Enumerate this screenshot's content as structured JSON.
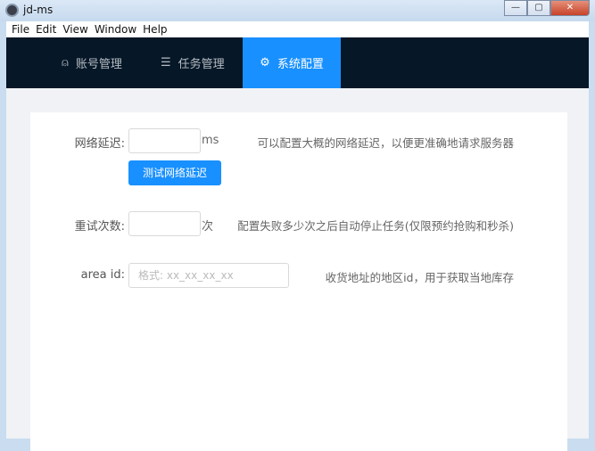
{
  "window": {
    "title": "jd-ms",
    "controls": {
      "minimize": "—",
      "maximize": "▢",
      "close": "✕"
    }
  },
  "menu": [
    "File",
    "Edit",
    "View",
    "Window",
    "Help"
  ],
  "nav": [
    {
      "label": "账号管理",
      "icon": "user-icon",
      "glyph": "⍝"
    },
    {
      "label": "任务管理",
      "icon": "list-icon",
      "glyph": "☰"
    },
    {
      "label": "系统配置",
      "icon": "gear-icon",
      "glyph": "⚙",
      "active": true
    }
  ],
  "form": {
    "delay": {
      "label": "网络延迟:",
      "value": "",
      "unit": "ms",
      "hint": "可以配置大概的网络延迟，以便更准确地请求服务器",
      "button": "测试网络延迟"
    },
    "retry": {
      "label": "重试次数:",
      "value": "",
      "unit": "次",
      "hint": "配置失败多少次之后自动停止任务(仅限预约抢购和秒杀)"
    },
    "area": {
      "label": "area id:",
      "value": "",
      "placeholder": "格式: xx_xx_xx_xx",
      "hint": "收货地址的地区id，用于获取当地库存"
    }
  },
  "colors": {
    "accent": "#1890ff",
    "nav_bg": "#061727"
  }
}
